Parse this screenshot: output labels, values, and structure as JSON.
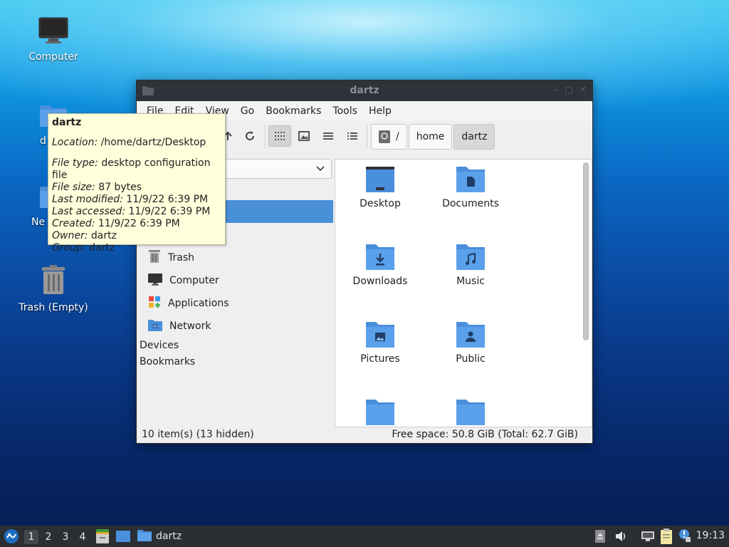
{
  "desktop": {
    "icons": [
      {
        "label": "Computer",
        "icon": "monitor-icon"
      },
      {
        "label": "dartz",
        "icon": "folder-icon"
      },
      {
        "label": "Network",
        "icon": "folder-icon"
      },
      {
        "label": "Trash (Empty)",
        "icon": "trash-icon"
      }
    ],
    "partial_labels": {
      "home": "d",
      "network": "Ne"
    }
  },
  "window": {
    "title": "dartz",
    "menu": [
      "File",
      "Edit",
      "View",
      "Go",
      "Bookmarks",
      "Tools",
      "Help"
    ],
    "breadcrumb": [
      "/",
      "home",
      "dartz"
    ],
    "sidebar": {
      "items": [
        {
          "label": "Trash",
          "icon": "trash-icon"
        },
        {
          "label": "Computer",
          "icon": "monitor-icon"
        },
        {
          "label": "Applications",
          "icon": "applications-icon"
        },
        {
          "label": "Network",
          "icon": "network-icon"
        }
      ],
      "headers": [
        "Devices",
        "Bookmarks"
      ]
    },
    "files": [
      {
        "name": "Desktop",
        "icon": "desktop-folder-icon"
      },
      {
        "name": "Documents",
        "icon": "documents-folder-icon"
      },
      {
        "name": "Downloads",
        "icon": "downloads-folder-icon"
      },
      {
        "name": "Music",
        "icon": "music-folder-icon"
      },
      {
        "name": "Pictures",
        "icon": "pictures-folder-icon"
      },
      {
        "name": "Public",
        "icon": "public-folder-icon"
      }
    ],
    "status": {
      "items": "10 item(s) (13 hidden)",
      "free_space": "Free space: 50.8 GiB (Total: 62.7 GiB)"
    }
  },
  "tooltip": {
    "title": "dartz",
    "location_key": "Location:",
    "location_val": " /home/dartz/Desktop",
    "type_key": "File type:",
    "type_val": " desktop configuration file",
    "size_key": "File size:",
    "size_val": " 87 bytes",
    "modified_key": "Last modified:",
    "modified_val": " 11/9/22 6:39 PM",
    "accessed_key": "Last accessed:",
    "accessed_val": " 11/9/22 6:39 PM",
    "created_key": "Created:",
    "created_val": " 11/9/22 6:39 PM",
    "owner_key": "Owner:",
    "owner_val": " dartz",
    "group_key": "Group:",
    "group_val": " dartz"
  },
  "taskbar": {
    "workspaces": [
      "1",
      "2",
      "3",
      "4"
    ],
    "active_workspace": "1",
    "task_label": "dartz",
    "clock": "19:13"
  },
  "colors": {
    "selection": "#4a90d9",
    "folder": "#4a8fdc",
    "titlebar": "#2f3238",
    "taskbar": "#2b2e33",
    "tooltip": "#ffffdc"
  }
}
